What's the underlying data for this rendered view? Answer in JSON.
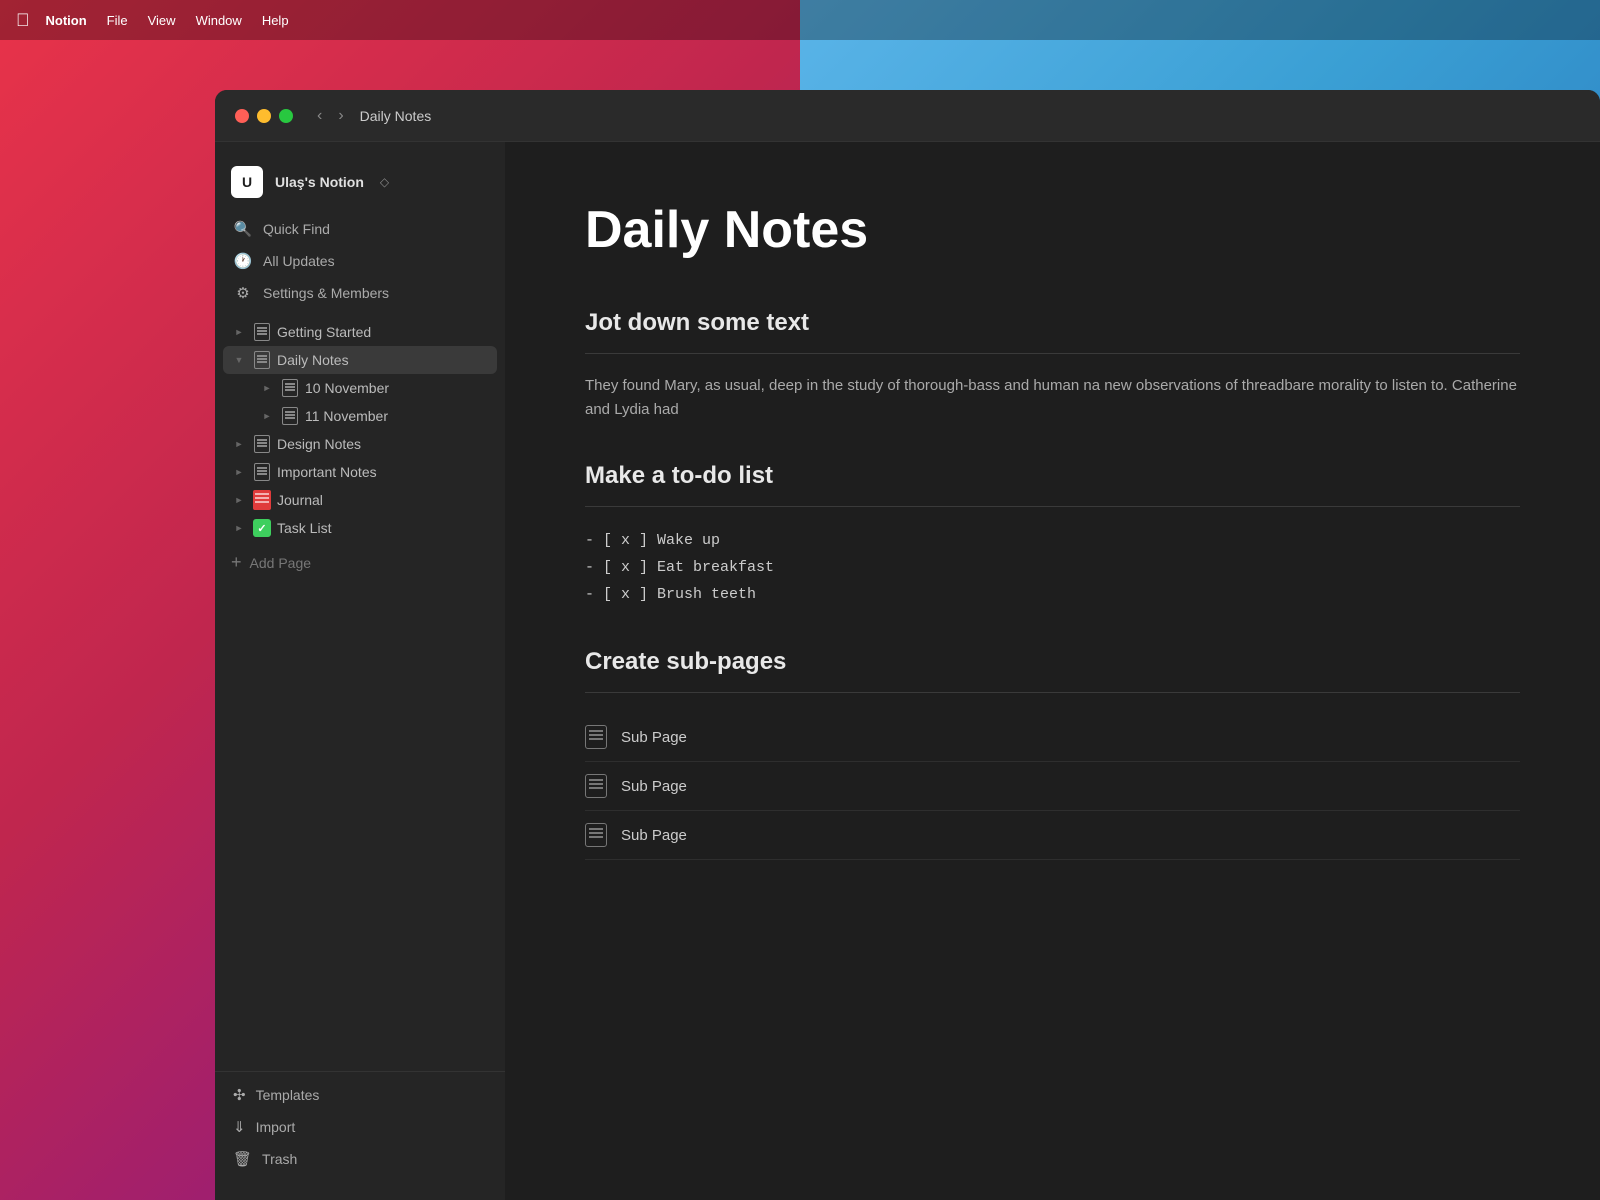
{
  "menubar": {
    "apple_symbol": "🍎",
    "items": [
      "Notion",
      "File",
      "View",
      "Window",
      "Help"
    ]
  },
  "titlebar": {
    "window_title": "Daily Notes",
    "nav_back": "‹",
    "nav_forward": "›"
  },
  "sidebar": {
    "workspace": {
      "icon_letter": "U",
      "name": "Ulaş's Notion",
      "chevron": "◇"
    },
    "nav_items": [
      {
        "id": "quick-find",
        "icon": "🔍",
        "label": "Quick Find"
      },
      {
        "id": "all-updates",
        "icon": "🕐",
        "label": "All Updates"
      },
      {
        "id": "settings",
        "icon": "⚙️",
        "label": "Settings & Members"
      }
    ],
    "pages": [
      {
        "id": "getting-started",
        "label": "Getting Started",
        "expanded": false,
        "indent": 0
      },
      {
        "id": "daily-notes",
        "label": "Daily Notes",
        "expanded": true,
        "indent": 0,
        "active": true
      },
      {
        "id": "10-november",
        "label": "10 November",
        "expanded": false,
        "indent": 1
      },
      {
        "id": "11-november",
        "label": "11 November",
        "expanded": false,
        "indent": 1
      },
      {
        "id": "design-notes",
        "label": "Design Notes",
        "expanded": false,
        "indent": 0
      },
      {
        "id": "important-notes",
        "label": "Important Notes",
        "expanded": false,
        "indent": 0
      },
      {
        "id": "journal",
        "label": "Journal",
        "expanded": false,
        "indent": 0,
        "special": "journal"
      },
      {
        "id": "task-list",
        "label": "Task List",
        "expanded": false,
        "indent": 0,
        "special": "task"
      }
    ],
    "add_page_label": "Add Page",
    "bottom_items": [
      {
        "id": "templates",
        "icon": "templates",
        "label": "Templates"
      },
      {
        "id": "import",
        "icon": "import",
        "label": "Import"
      },
      {
        "id": "trash",
        "icon": "trash",
        "label": "Trash"
      }
    ]
  },
  "main": {
    "page_title": "Daily Notes",
    "sections": [
      {
        "id": "jot-down",
        "heading": "Jot down some text",
        "content": "They found Mary, as usual, deep in the study of thorough-bass and human na new observations of threadbare morality to listen to. Catherine and Lydia had",
        "type": "paragraph"
      },
      {
        "id": "todo-list",
        "heading": "Make a to-do list",
        "type": "todo",
        "items": [
          "- [ x ]  Wake up",
          "- [ x ]  Eat breakfast",
          "- [ x ]  Brush teeth"
        ]
      },
      {
        "id": "sub-pages",
        "heading": "Create sub-pages",
        "type": "subpages",
        "items": [
          "Sub Page",
          "Sub Page",
          "Sub Page"
        ]
      }
    ]
  }
}
